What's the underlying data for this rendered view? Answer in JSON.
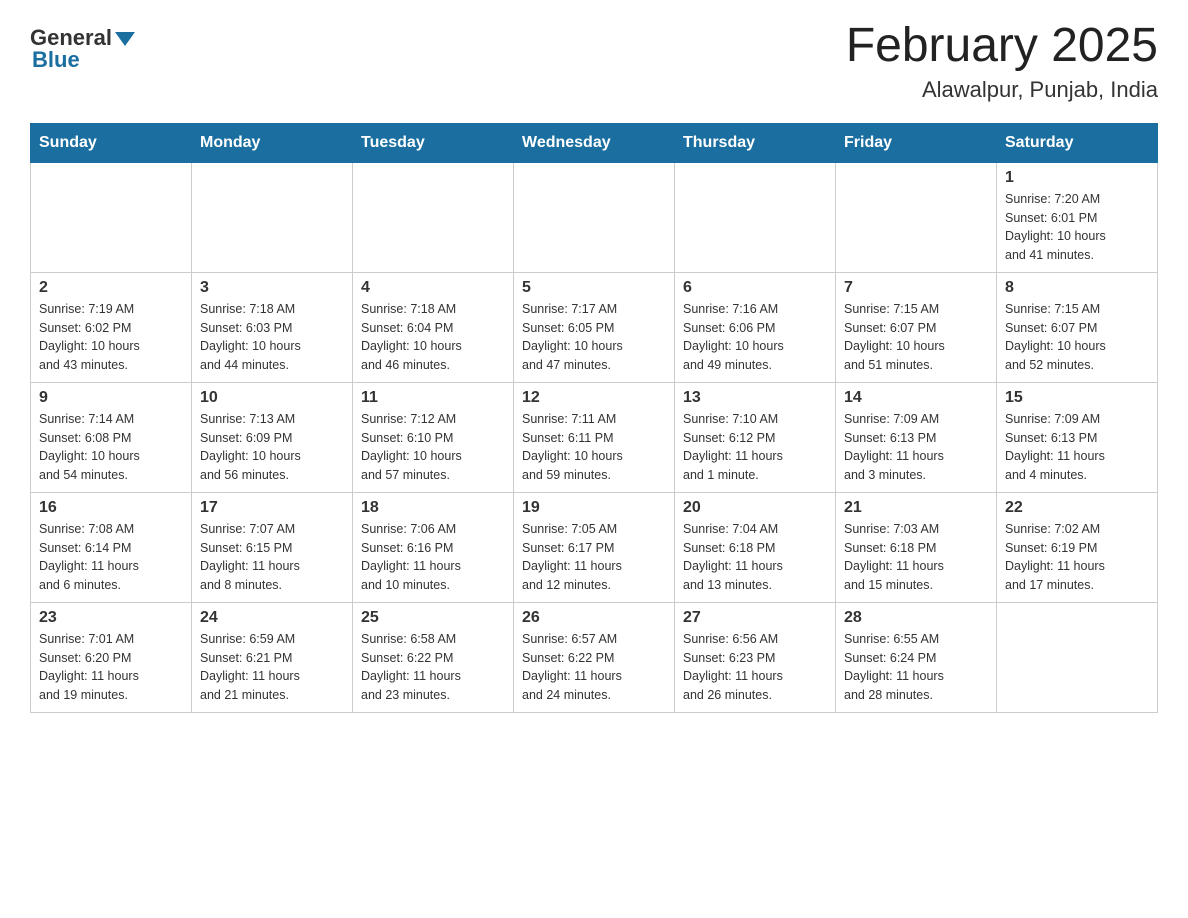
{
  "logo": {
    "general": "General",
    "blue": "Blue"
  },
  "title": "February 2025",
  "subtitle": "Alawalpur, Punjab, India",
  "days_of_week": [
    "Sunday",
    "Monday",
    "Tuesday",
    "Wednesday",
    "Thursday",
    "Friday",
    "Saturday"
  ],
  "weeks": [
    [
      {
        "day": "",
        "info": ""
      },
      {
        "day": "",
        "info": ""
      },
      {
        "day": "",
        "info": ""
      },
      {
        "day": "",
        "info": ""
      },
      {
        "day": "",
        "info": ""
      },
      {
        "day": "",
        "info": ""
      },
      {
        "day": "1",
        "info": "Sunrise: 7:20 AM\nSunset: 6:01 PM\nDaylight: 10 hours\nand 41 minutes."
      }
    ],
    [
      {
        "day": "2",
        "info": "Sunrise: 7:19 AM\nSunset: 6:02 PM\nDaylight: 10 hours\nand 43 minutes."
      },
      {
        "day": "3",
        "info": "Sunrise: 7:18 AM\nSunset: 6:03 PM\nDaylight: 10 hours\nand 44 minutes."
      },
      {
        "day": "4",
        "info": "Sunrise: 7:18 AM\nSunset: 6:04 PM\nDaylight: 10 hours\nand 46 minutes."
      },
      {
        "day": "5",
        "info": "Sunrise: 7:17 AM\nSunset: 6:05 PM\nDaylight: 10 hours\nand 47 minutes."
      },
      {
        "day": "6",
        "info": "Sunrise: 7:16 AM\nSunset: 6:06 PM\nDaylight: 10 hours\nand 49 minutes."
      },
      {
        "day": "7",
        "info": "Sunrise: 7:15 AM\nSunset: 6:07 PM\nDaylight: 10 hours\nand 51 minutes."
      },
      {
        "day": "8",
        "info": "Sunrise: 7:15 AM\nSunset: 6:07 PM\nDaylight: 10 hours\nand 52 minutes."
      }
    ],
    [
      {
        "day": "9",
        "info": "Sunrise: 7:14 AM\nSunset: 6:08 PM\nDaylight: 10 hours\nand 54 minutes."
      },
      {
        "day": "10",
        "info": "Sunrise: 7:13 AM\nSunset: 6:09 PM\nDaylight: 10 hours\nand 56 minutes."
      },
      {
        "day": "11",
        "info": "Sunrise: 7:12 AM\nSunset: 6:10 PM\nDaylight: 10 hours\nand 57 minutes."
      },
      {
        "day": "12",
        "info": "Sunrise: 7:11 AM\nSunset: 6:11 PM\nDaylight: 10 hours\nand 59 minutes."
      },
      {
        "day": "13",
        "info": "Sunrise: 7:10 AM\nSunset: 6:12 PM\nDaylight: 11 hours\nand 1 minute."
      },
      {
        "day": "14",
        "info": "Sunrise: 7:09 AM\nSunset: 6:13 PM\nDaylight: 11 hours\nand 3 minutes."
      },
      {
        "day": "15",
        "info": "Sunrise: 7:09 AM\nSunset: 6:13 PM\nDaylight: 11 hours\nand 4 minutes."
      }
    ],
    [
      {
        "day": "16",
        "info": "Sunrise: 7:08 AM\nSunset: 6:14 PM\nDaylight: 11 hours\nand 6 minutes."
      },
      {
        "day": "17",
        "info": "Sunrise: 7:07 AM\nSunset: 6:15 PM\nDaylight: 11 hours\nand 8 minutes."
      },
      {
        "day": "18",
        "info": "Sunrise: 7:06 AM\nSunset: 6:16 PM\nDaylight: 11 hours\nand 10 minutes."
      },
      {
        "day": "19",
        "info": "Sunrise: 7:05 AM\nSunset: 6:17 PM\nDaylight: 11 hours\nand 12 minutes."
      },
      {
        "day": "20",
        "info": "Sunrise: 7:04 AM\nSunset: 6:18 PM\nDaylight: 11 hours\nand 13 minutes."
      },
      {
        "day": "21",
        "info": "Sunrise: 7:03 AM\nSunset: 6:18 PM\nDaylight: 11 hours\nand 15 minutes."
      },
      {
        "day": "22",
        "info": "Sunrise: 7:02 AM\nSunset: 6:19 PM\nDaylight: 11 hours\nand 17 minutes."
      }
    ],
    [
      {
        "day": "23",
        "info": "Sunrise: 7:01 AM\nSunset: 6:20 PM\nDaylight: 11 hours\nand 19 minutes."
      },
      {
        "day": "24",
        "info": "Sunrise: 6:59 AM\nSunset: 6:21 PM\nDaylight: 11 hours\nand 21 minutes."
      },
      {
        "day": "25",
        "info": "Sunrise: 6:58 AM\nSunset: 6:22 PM\nDaylight: 11 hours\nand 23 minutes."
      },
      {
        "day": "26",
        "info": "Sunrise: 6:57 AM\nSunset: 6:22 PM\nDaylight: 11 hours\nand 24 minutes."
      },
      {
        "day": "27",
        "info": "Sunrise: 6:56 AM\nSunset: 6:23 PM\nDaylight: 11 hours\nand 26 minutes."
      },
      {
        "day": "28",
        "info": "Sunrise: 6:55 AM\nSunset: 6:24 PM\nDaylight: 11 hours\nand 28 minutes."
      },
      {
        "day": "",
        "info": ""
      }
    ]
  ]
}
